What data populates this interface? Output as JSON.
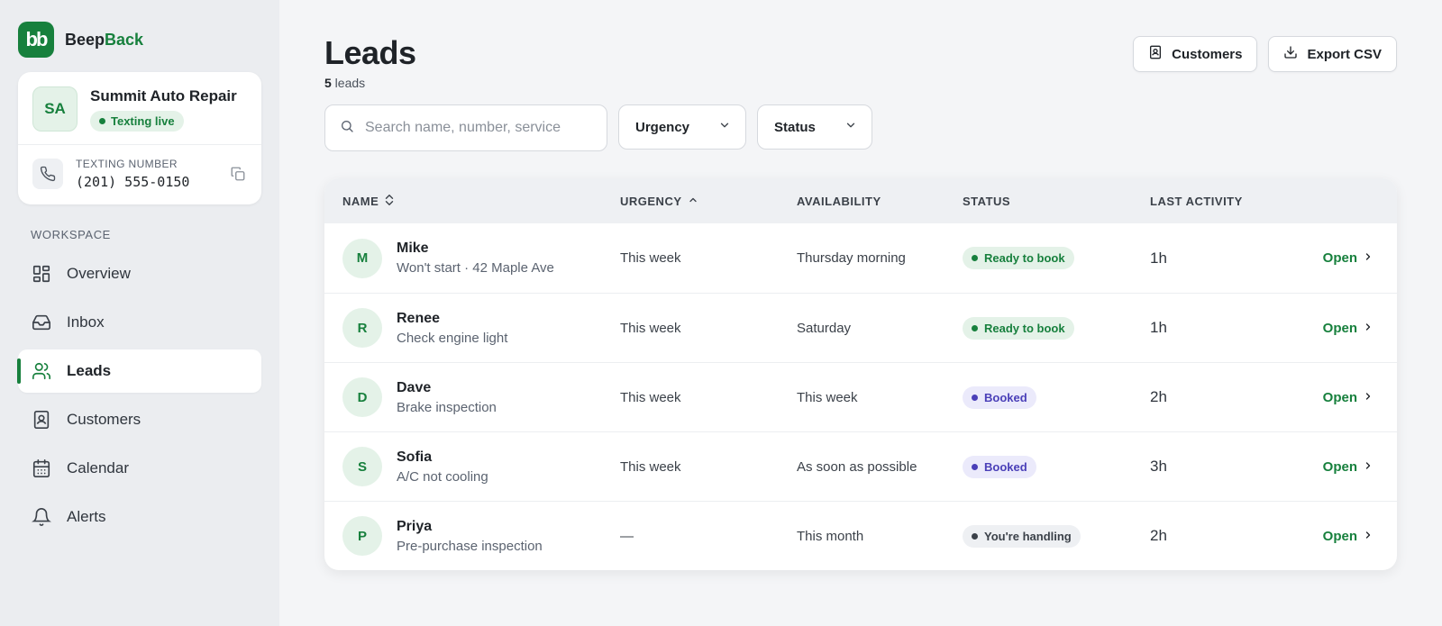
{
  "brand": {
    "logo_text": "bb",
    "name_a": "Beep",
    "name_b": "Back",
    "color": "#17803d"
  },
  "business": {
    "initials": "SA",
    "name": "Summit Auto Repair",
    "live_label": "Texting live",
    "number_label": "TEXTING NUMBER",
    "number": "(201) 555-0150"
  },
  "sidebar": {
    "section_label": "WORKSPACE",
    "items": [
      {
        "label": "Overview",
        "icon": "grid-icon"
      },
      {
        "label": "Inbox",
        "icon": "inbox-icon"
      },
      {
        "label": "Leads",
        "icon": "users-icon",
        "active": true
      },
      {
        "label": "Customers",
        "icon": "contact-book-icon"
      },
      {
        "label": "Calendar",
        "icon": "calendar-icon"
      },
      {
        "label": "Alerts",
        "icon": "bell-icon"
      }
    ]
  },
  "header": {
    "title": "Leads",
    "count_number": "5",
    "count_label": " leads",
    "customers_btn": "Customers",
    "export_btn": "Export CSV"
  },
  "filters": {
    "search_placeholder": "Search name, number, service",
    "search_value": "",
    "urgency_label": "Urgency",
    "status_label": "Status"
  },
  "table": {
    "columns": {
      "name": "NAME",
      "urgency": "URGENCY",
      "availability": "AVAILABILITY",
      "status": "STATUS",
      "last_activity": "LAST ACTIVITY"
    },
    "open_label": "Open",
    "rows": [
      {
        "initial": "M",
        "name": "Mike",
        "sub": "Won't start · 42 Maple Ave",
        "urgency": "This week",
        "availability": "Thursday morning",
        "status": "Ready to book",
        "status_tone": "green",
        "last": "1h"
      },
      {
        "initial": "R",
        "name": "Renee",
        "sub": "Check engine light",
        "urgency": "This week",
        "availability": "Saturday",
        "status": "Ready to book",
        "status_tone": "green",
        "last": "1h"
      },
      {
        "initial": "D",
        "name": "Dave",
        "sub": "Brake inspection",
        "urgency": "This week",
        "availability": "This week",
        "status": "Booked",
        "status_tone": "purple",
        "last": "2h"
      },
      {
        "initial": "S",
        "name": "Sofia",
        "sub": "A/C not cooling",
        "urgency": "This week",
        "availability": "As soon as possible",
        "status": "Booked",
        "status_tone": "purple",
        "last": "3h"
      },
      {
        "initial": "P",
        "name": "Priya",
        "sub": "Pre-purchase inspection",
        "urgency": "—",
        "availability": "This month",
        "status": "You're handling",
        "status_tone": "gray",
        "last": "2h"
      }
    ]
  }
}
